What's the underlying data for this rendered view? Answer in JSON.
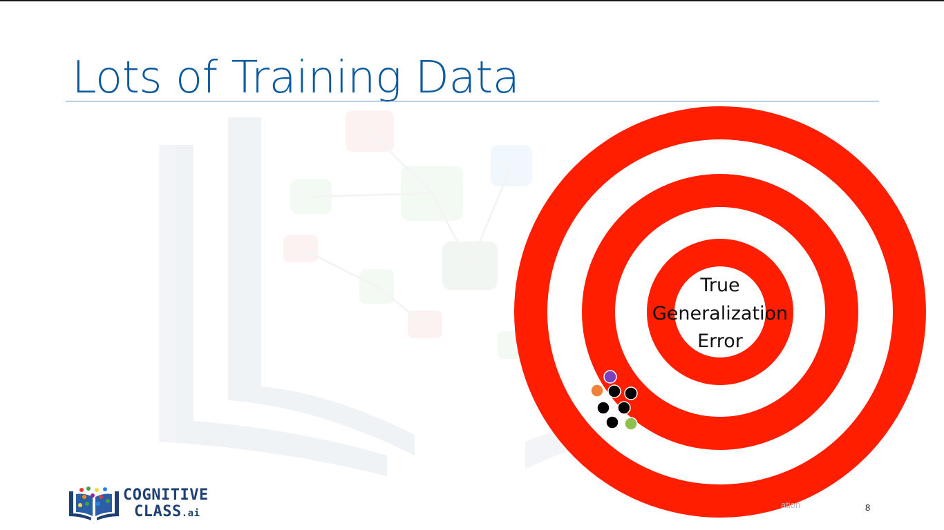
{
  "slide": {
    "title": "Lots of Training Data",
    "page_number": "8",
    "footer_text": "ation"
  },
  "target": {
    "center_label_lines": [
      "True",
      "Generalization",
      "Error"
    ],
    "ring_color": "#ff1e00",
    "shots": [
      {
        "color": "#7b3fbf"
      },
      {
        "color": "#f0823a"
      },
      {
        "color": "#000000"
      },
      {
        "color": "#000000"
      },
      {
        "color": "#000000"
      },
      {
        "color": "#000000"
      },
      {
        "color": "#000000"
      },
      {
        "color": "#8cc152"
      }
    ]
  },
  "logo": {
    "line1": "COGNITIVE",
    "line2": "CLASS",
    "suffix": ".ai"
  },
  "colors": {
    "title": "#0d5aa0",
    "logo_text": "#1e3f72"
  }
}
